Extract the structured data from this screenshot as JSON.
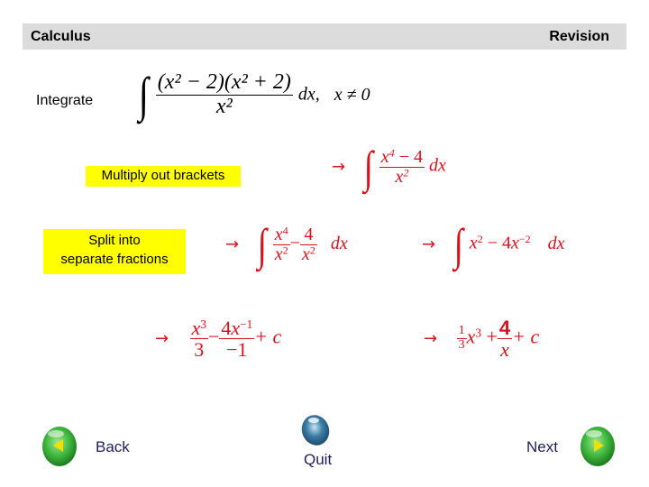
{
  "header": {
    "left_title": "Calculus",
    "right_title": "Revision"
  },
  "prompt": {
    "label": "Integrate"
  },
  "problem": {
    "factor1": "(x² − 2)",
    "factor2": "(x² + 2)",
    "denominator": "x²",
    "differential": "dx,",
    "condition": "x ≠ 0"
  },
  "steps": {
    "multiply_label": "Multiply out brackets",
    "split_label_line1": "Split into",
    "split_label_line2": "separate fractions",
    "step1": {
      "arrow": "→",
      "num_base": "x",
      "num_exp": "4",
      "num_rest": " − 4",
      "den_base": "x",
      "den_exp": "2",
      "dx": "dx"
    },
    "step2": {
      "arrow": "→",
      "f1_num_base": "x",
      "f1_num_exp": "4",
      "f1_den_base": "x",
      "f1_den_exp": "2",
      "minus": "−",
      "f2_num": "4",
      "f2_den_base": "x",
      "f2_den_exp": "2",
      "dx": "dx"
    },
    "step3": {
      "arrow": "→",
      "t1_base": "x",
      "t1_exp": "2",
      "op": " − 4",
      "t2_base": "x",
      "t2_exp": "−2",
      "dx": "dx"
    },
    "step4": {
      "arrow": "→",
      "f1_num_base": "x",
      "f1_num_exp": "3",
      "f1_den": "3",
      "minus": "−",
      "f2_num_coef": "4",
      "f2_num_base": "x",
      "f2_num_exp": "−1",
      "f2_den": "−1",
      "tail": "+ c"
    },
    "step5": {
      "arrow": "→",
      "coef_num": "1",
      "coef_den": "3",
      "base": "x",
      "exp": "3",
      "plus": "+",
      "f_num": "4",
      "f_den": "x",
      "tail": "+ c"
    }
  },
  "nav": {
    "back_label": "Back",
    "quit_label": "Quit",
    "next_label": "Next",
    "back_icon": "left-arrow-ball-icon",
    "quit_icon": "blue-orb-icon",
    "next_icon": "right-arrow-ball-icon",
    "colors": {
      "nav_text": "#1e1e5a",
      "ball_green": "#3cb43c",
      "arrow_yellow": "#f0e000",
      "orb_blue": "#3d7ea6"
    }
  },
  "colors": {
    "header_bg": "#dcdcdc",
    "highlight": "#ffff00",
    "math_red": "#d4141c"
  }
}
